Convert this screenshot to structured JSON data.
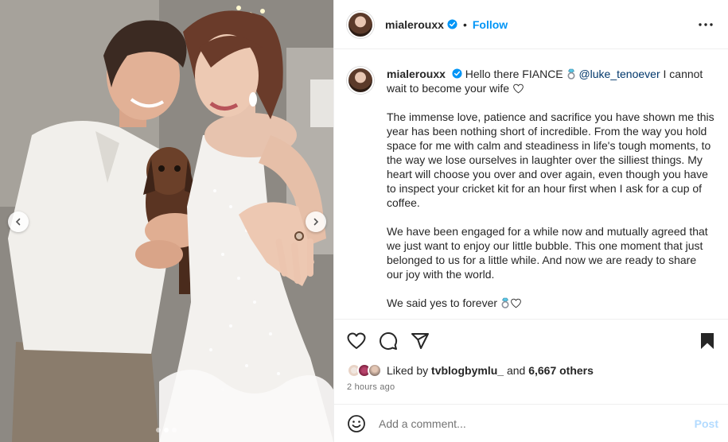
{
  "post": {
    "username": "mialerouxx",
    "separator": "•",
    "follow_label": "Follow",
    "more_icon": "more-horizontal-icon",
    "verified_icon": "verified-badge-icon"
  },
  "caption": {
    "username": "mialerouxx",
    "intro_text": "Hello there FIANCE",
    "mention": "@luke_tenoever",
    "intro_text_2": "I cannot wait to become your wife",
    "paragraph_2": "The immense love, patience and sacrifice you have shown me this year has been nothing short of incredible. From the way you hold space for me with calm and steadiness in life's tough moments, to the way we lose ourselves in laughter over the silliest things. My heart will choose you over and over again, even though you have to inspect your cricket kit for an hour first when I ask for a cup of coffee.",
    "paragraph_3": "We have been engaged for a while now and mutually agreed that we just want to enjoy our little bubble. This one moment that just belonged to us for a little while. And now we are ready to share our joy with the world.",
    "paragraph_4": "We said yes to forever"
  },
  "likes": {
    "prefix": "Liked by",
    "liker": "tvblogbymlu_",
    "middle": "and",
    "others": "6,667 others"
  },
  "timestamp": "2 hours ago",
  "comment": {
    "placeholder": "Add a comment...",
    "post_label": "Post"
  },
  "carousel": {
    "slide_count": 3,
    "active_index": 1
  },
  "colors": {
    "link": "#0095f6",
    "mention": "#00376b",
    "post_disabled": "#b3dbff",
    "meta": "#737373"
  }
}
